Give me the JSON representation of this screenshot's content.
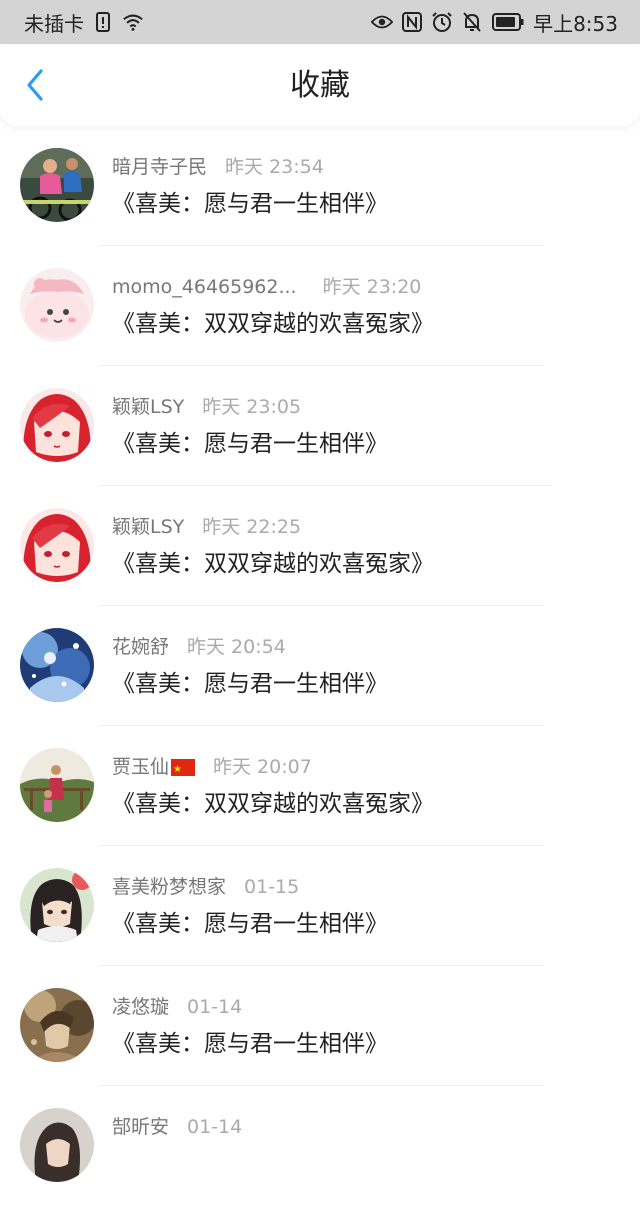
{
  "status_bar": {
    "carrier": "未插卡",
    "time": "早上8:53",
    "icons": [
      "sim-alert-icon",
      "wifi-icon",
      "eye-icon",
      "nfc-icon",
      "alarm-icon",
      "mute-icon",
      "battery-icon"
    ]
  },
  "header": {
    "title": "收藏",
    "back_icon": "chevron-left-icon",
    "accent_color": "#2d9bf0"
  },
  "items": [
    {
      "user": "暗月寺子民",
      "time": "昨天 23:54",
      "title": "《喜美：愿与君一生相伴》",
      "avatar": "photo-people-biking"
    },
    {
      "user": "momo_46465962...",
      "time": "昨天 23:20",
      "title": "《喜美：双双穿越的欢喜冤家》",
      "avatar": "pink-cartoon"
    },
    {
      "user": "颖颖LSY",
      "time": "昨天 23:05",
      "title": "《喜美：愿与君一生相伴》",
      "avatar": "red-hair-anime-girl"
    },
    {
      "user": "颖颖LSY",
      "time": "昨天 22:25",
      "title": "《喜美：双双穿越的欢喜冤家》",
      "avatar": "red-hair-anime-girl"
    },
    {
      "user": "花婉舒",
      "time": "昨天 20:54",
      "title": "《喜美：愿与君一生相伴》",
      "avatar": "blue-fantasy-art"
    },
    {
      "user": "贾玉仙",
      "time": "昨天 20:07",
      "title": "《喜美：双双穿越的欢喜冤家》",
      "avatar": "photo-people-outdoors",
      "flag": "china-flag-icon"
    },
    {
      "user": "喜美粉梦想家",
      "time": "01-15",
      "title": "《喜美：愿与君一生相伴》",
      "avatar": "anime-girl-dark-hair"
    },
    {
      "user": "凌悠璇",
      "time": "01-14",
      "title": "《喜美：愿与君一生相伴》",
      "avatar": "sepia-illustration"
    },
    {
      "user": "郜昕安",
      "time": "01-14",
      "title": "",
      "avatar": "portrait-photo"
    }
  ]
}
